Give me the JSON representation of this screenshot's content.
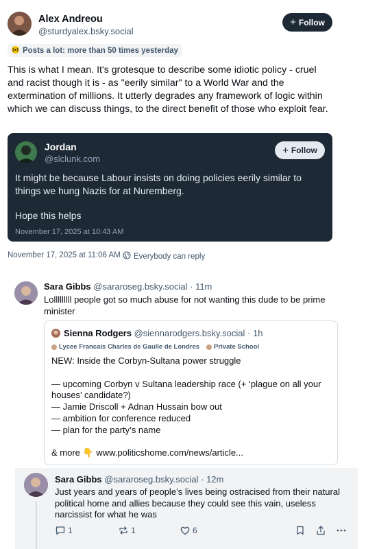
{
  "main_post": {
    "author_name": "Alex Andreou",
    "author_handle": "@sturdyalex.bsky.social",
    "follow_label": "Follow",
    "badge_text": "Posts a lot: more than 50 times yesterday",
    "text": "This is what I mean. It's grotesque to describe some idiotic policy - cruel and racist though it is - as \"eerily similar\" to a World War and the extermination of millions. It utterly degrades any framework of logic within which we can discuss things, to the direct benefit of those who exploit fear.",
    "timestamp": "November 17, 2025 at 11:06 AM",
    "reply_setting": "Everybody can reply"
  },
  "quoted_post": {
    "author_name": "Jordan",
    "author_handle": "@slclunk.com",
    "follow_label": "Follow",
    "text": "It might be because Labour insists on doing policies eerily similar to things we hung Nazis for at Nuremberg.",
    "text2": "Hope this helps",
    "timestamp": "November 17, 2025 at 10:43 AM"
  },
  "reply1": {
    "author_name": "Sara Gibbs",
    "author_handle": "@sararoseg.bsky.social",
    "age": "· 11m",
    "text": "Lolllllllll people got so much abuse for not wanting this dude to be prime minister",
    "quote": {
      "author_name": "Sienna Rodgers",
      "author_handle": "@siennarodgers.bsky.social",
      "age": "· 1h",
      "labels": [
        "Lycee Francais Charles de Gaulle de Londres",
        "Private School"
      ],
      "lines": [
        "NEW: Inside the Corbyn-Sultana power struggle",
        "",
        "— upcoming Corbyn v Sultana leadership race (+ ‘plague on all your houses’ candidate?)",
        "— Jamie Driscoll + Adnan Hussain bow out",
        "— ambition for conference reduced",
        "— plan for the party’s name",
        "",
        "& more 👇 www.politicshome.com/news/article..."
      ]
    }
  },
  "reply2": {
    "author_name": "Sara Gibbs",
    "author_handle": "@sararoseg.bsky.social",
    "age": "· 12m",
    "text": "Just years and years of people’s lives being ostracised from their natural political home and allies because they could see this vain, useless narcissist for what he was",
    "actions": {
      "replies": "1",
      "reposts": "1",
      "likes": "6"
    }
  },
  "icons": {
    "badge": "broadcast-icon",
    "reply_setting": "globe-icon",
    "reply": "speech-bubble-icon",
    "repost": "repost-icon",
    "like": "heart-icon",
    "bookmark": "bookmark-icon",
    "share": "share-icon",
    "more": "ellipsis-icon"
  },
  "colors": {
    "primary_dark": "#1e2936",
    "muted_text": "#42576c",
    "badge_accent": "#d99a00"
  }
}
